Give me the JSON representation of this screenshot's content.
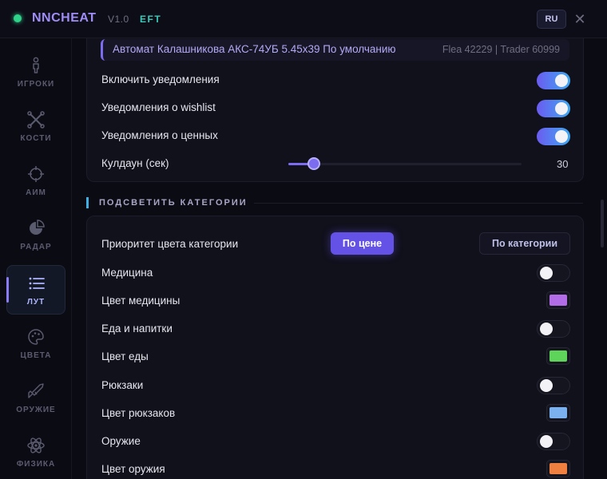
{
  "header": {
    "brand": "NNCHEAT",
    "version": "V1.0",
    "game": "EFT",
    "lang": "RU",
    "close_glyph": "✕",
    "status_color": "#2fd38a"
  },
  "sidebar": {
    "items": [
      {
        "label": "ИГРОКИ",
        "icon": "person-icon",
        "active": false
      },
      {
        "label": "КОСТИ",
        "icon": "bones-icon",
        "active": false
      },
      {
        "label": "АИМ",
        "icon": "crosshair-icon",
        "active": false
      },
      {
        "label": "РАДАР",
        "icon": "radar-icon",
        "active": false
      },
      {
        "label": "ЛУТ",
        "icon": "list-icon",
        "active": true
      },
      {
        "label": "ЦВЕТА",
        "icon": "palette-icon",
        "active": false
      },
      {
        "label": "ОРУЖИЕ",
        "icon": "rifle-icon",
        "active": false
      },
      {
        "label": "ФИЗИКА",
        "icon": "atom-icon",
        "active": false
      }
    ]
  },
  "notifications": {
    "item": {
      "name": "Автомат Калашникова АКС-74УБ 5.45x39 По умолчанию",
      "prices": "Flea 42229 | Trader 60999"
    },
    "toggles": [
      {
        "label": "Включить уведомления",
        "on": true
      },
      {
        "label": "Уведомления о wishlist",
        "on": true
      },
      {
        "label": "Уведомления о ценных",
        "on": true
      }
    ],
    "cooldown": {
      "label": "Кулдаун (сек)",
      "value": "30",
      "level_fraction": 0.11
    }
  },
  "highlight": {
    "section_title": "ПОДСВЕТИТЬ КАТЕГОРИИ",
    "priority": {
      "label": "Приоритет цвета категории",
      "options": [
        "По цене",
        "По категории"
      ],
      "selected": "По цене"
    },
    "rows": [
      {
        "type": "toggle",
        "label": "Медицина",
        "on": false
      },
      {
        "type": "color",
        "label": "Цвет медицины",
        "color": "#b26ce8"
      },
      {
        "type": "toggle",
        "label": "Еда и напитки",
        "on": false
      },
      {
        "type": "color",
        "label": "Цвет еды",
        "color": "#5fd45a"
      },
      {
        "type": "toggle",
        "label": "Рюкзаки",
        "on": false
      },
      {
        "type": "color",
        "label": "Цвет рюкзаков",
        "color": "#7cb1f0"
      },
      {
        "type": "toggle",
        "label": "Оружие",
        "on": false
      },
      {
        "type": "color",
        "label": "Цвет оружия",
        "color": "#f08040"
      }
    ]
  },
  "colors": {
    "accent": "#6452e6",
    "toggle_on_start": "#6b5cf0",
    "toggle_on_end": "#3da8f2"
  }
}
